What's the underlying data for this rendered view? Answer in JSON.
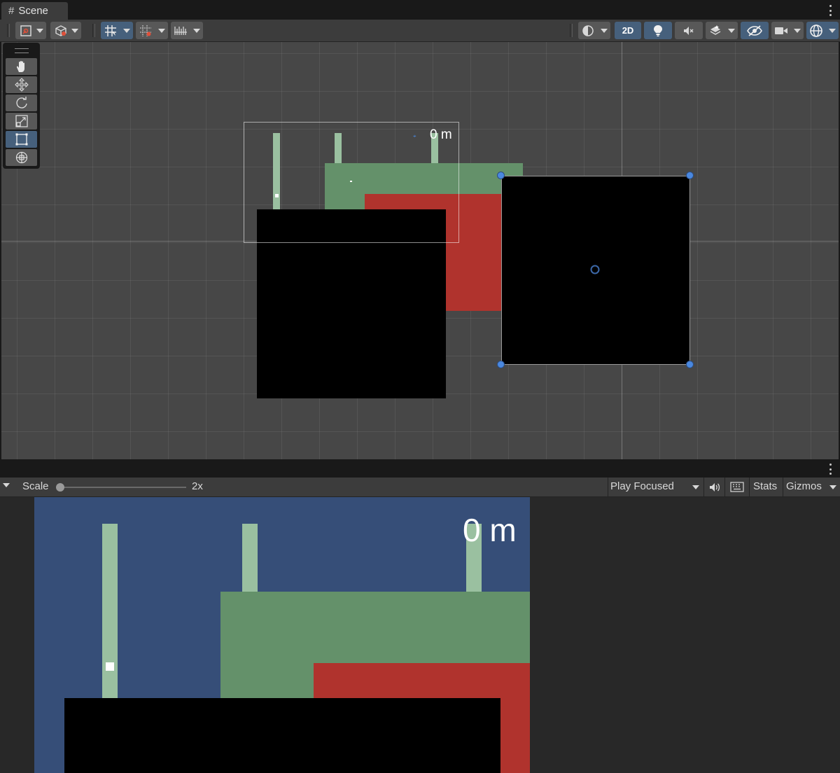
{
  "scene": {
    "tab_label": "Scene",
    "toolbar": {
      "mode_2d_label": "2D"
    },
    "distance_label": "0 m"
  },
  "game": {
    "scale_label": "Scale",
    "scale_value_label": "2x",
    "scale_value": 0,
    "play_mode_label": "Play Focused",
    "stats_label": "Stats",
    "gizmos_label": "Gizmos",
    "distance_label": "0 m"
  },
  "colors": {
    "camera_background": "#364e78",
    "platform_green": "#64916a",
    "pillar_green": "#9ac0a0",
    "block_red": "#b0332d",
    "block_black": "#000000",
    "selection_handle": "#4a88e0",
    "active_button": "#46607c"
  }
}
